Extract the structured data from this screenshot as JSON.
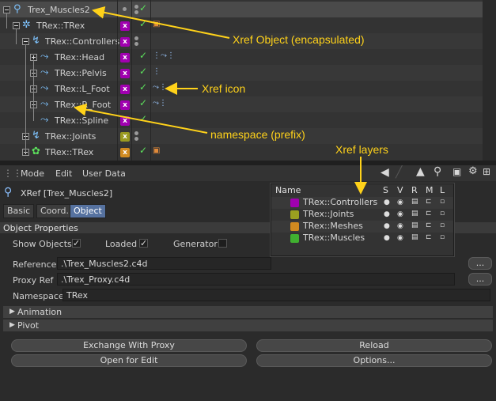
{
  "object_manager": {
    "rows": [
      {
        "name": "Trex_Muscles2"
      },
      {
        "name": "TRex::TRex"
      },
      {
        "name": "TRex::Controllers"
      },
      {
        "name": "TRex::Head"
      },
      {
        "name": "TRex::Pelvis"
      },
      {
        "name": "TRex::L_Foot"
      },
      {
        "name": "TRex::R_Foot"
      },
      {
        "name": "TRex::Spline"
      },
      {
        "name": "TRex::Joints"
      },
      {
        "name": "TRex::TRex"
      }
    ],
    "check_mark": "✓",
    "tag_label": "x"
  },
  "attribute_manager": {
    "menu": [
      "Mode",
      "Edit",
      "User Data"
    ],
    "title": "XRef [Trex_Muscles2]",
    "tabs": [
      "Basic",
      "Coord.",
      "Object"
    ],
    "section": "Object Properties",
    "show_objects_label": "Show Objects",
    "loaded_label": "Loaded",
    "generator_label": "Generator",
    "reference_label": "Reference",
    "reference_value": ".\\Trex_Muscles2.c4d",
    "proxy_label": "Proxy Ref",
    "proxy_value": ".\\Trex_Proxy.c4d",
    "namespace_label": "Namespace",
    "namespace_value": "TRex",
    "browse_button": "...",
    "animation_label": "Animation",
    "pivot_label": "Pivot",
    "buttons": {
      "exchange": "Exchange With Proxy",
      "reload": "Reload",
      "open": "Open for Edit",
      "options": "Options..."
    }
  },
  "layers_panel": {
    "headers": [
      "Name",
      "S",
      "V",
      "R",
      "M",
      "L"
    ],
    "layers": [
      {
        "name": "TRex::Controllers",
        "color": "#a000b0"
      },
      {
        "name": "TRex::Joints",
        "color": "#9aa020"
      },
      {
        "name": "TRex::Meshes",
        "color": "#d08a20"
      },
      {
        "name": "TRex::Muscles",
        "color": "#40b030"
      }
    ]
  },
  "annotations": {
    "xref_object": "Xref Object (encapsulated)",
    "xref_icon": "Xref icon",
    "namespace": "namespace (prefix)",
    "xref_layers": "Xref layers"
  },
  "colors": {
    "annotation": "#ffd21a",
    "active_tab": "#5672a0"
  }
}
